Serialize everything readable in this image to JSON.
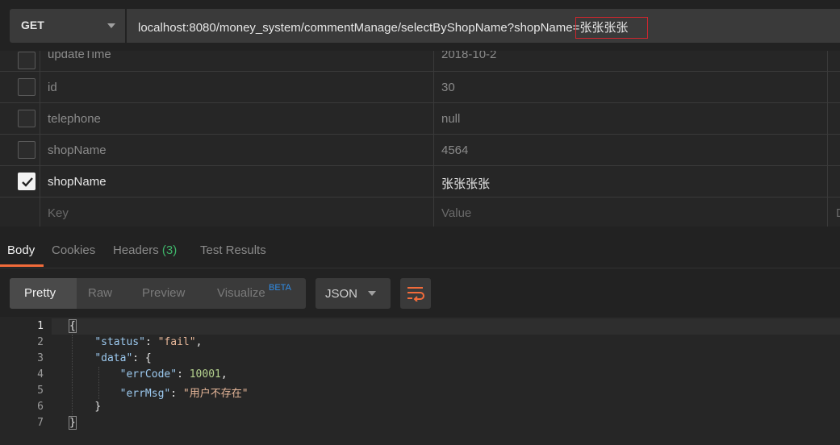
{
  "request": {
    "method": "GET",
    "url_prefix": "localhost:8080/money_system/commentManage/selectByShopName?shopName=",
    "url_highlight": "张张张张"
  },
  "params": {
    "rows": [
      {
        "key": "updateTime",
        "value": "2018-10-2",
        "checked": false
      },
      {
        "key": "id",
        "value": "30",
        "checked": false
      },
      {
        "key": "telephone",
        "value": "null",
        "checked": false
      },
      {
        "key": "shopName",
        "value": "4564",
        "checked": false
      },
      {
        "key": "shopName",
        "value": "张张张张",
        "checked": true
      }
    ],
    "new_row": {
      "key_placeholder": "Key",
      "value_placeholder": "Value",
      "desc_placeholder": "D"
    }
  },
  "response": {
    "tabs": [
      {
        "label": "Body",
        "active": true
      },
      {
        "label": "Cookies"
      },
      {
        "label": "Headers",
        "count": "(3)"
      },
      {
        "label": "Test Results"
      }
    ],
    "views": {
      "pretty": "Pretty",
      "raw": "Raw",
      "preview": "Preview",
      "visualize": "Visualize",
      "beta": "BETA"
    },
    "format": "JSON",
    "line_numbers": [
      "1",
      "2",
      "3",
      "4",
      "5",
      "6",
      "7"
    ],
    "body": {
      "open_brace": "{",
      "status_key": "\"status\"",
      "status_value": "\"fail\"",
      "data_key": "\"data\"",
      "errcode_key": "\"errCode\"",
      "errcode_value": "10001",
      "errmsg_key": "\"errMsg\"",
      "errmsg_value": "\"用户不存在\"",
      "inner_close": "}",
      "close_brace": "}"
    }
  },
  "colors": {
    "accent": "#f26b3a",
    "highlight_border": "#d0262e",
    "count_green": "#3fb56a",
    "beta_blue": "#2f8ce6"
  }
}
